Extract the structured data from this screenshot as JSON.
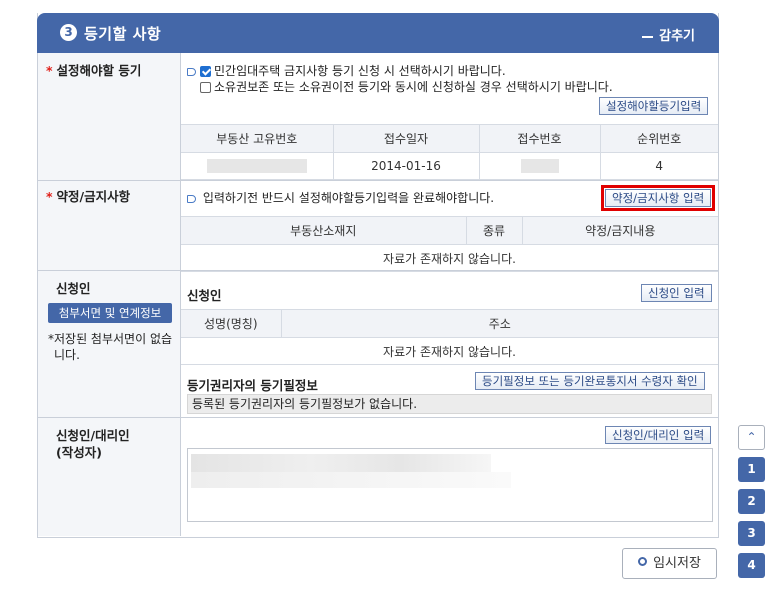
{
  "header": {
    "number": "3",
    "title": "등기할 사항",
    "fold_label": "감추기"
  },
  "registration": {
    "label": "설정해야할 등기",
    "option1": "민간임대주택 금지사항 등기 신청 시 선택하시기 바랍니다.",
    "option1_checked": true,
    "option2": "소유권보존 또는 소유권이전 등기와 동시에 신청하실 경우 선택하시기 바랍니다.",
    "option2_checked": false,
    "button": "설정해야할등기입력",
    "columns": [
      "부동산 고유번호",
      "접수일자",
      "접수번호",
      "순위번호"
    ],
    "row": {
      "receipt_date": "2014-01-16",
      "rank": "4"
    }
  },
  "covenant": {
    "label": "약정/금지사항",
    "notice": "입력하기전 반드시 설정해야할등기입력을 완료해야합니다.",
    "button": "약정/금지사항 입력",
    "columns": [
      "부동산소재지",
      "종류",
      "약정/금지내용"
    ],
    "empty": "자료가 존재하지 않습니다."
  },
  "applicant": {
    "label": "신청인",
    "attach_button": "첨부서면 및 연계정보",
    "note": "저장된 첨부서면이 없습니다.",
    "subtitle": "신청인",
    "button": "신청인 입력",
    "columns": [
      "성명(명칭)",
      "주소"
    ],
    "empty": "자료가 존재하지 않습니다.",
    "cert_title": "등기권리자의 등기필정보",
    "cert_button": "등기필정보 또는 등기완료통지서 수령자 확인",
    "cert_info": "등록된 등기권리자의 등기필정보가 없습니다."
  },
  "agent": {
    "label_line1": "신청인/대리인",
    "label_line2": "(작성자)",
    "button": "신청인/대리인 입력"
  },
  "footer": {
    "save_label": "임시저장"
  },
  "side_nav": {
    "items": [
      "1",
      "2",
      "3",
      "4"
    ]
  },
  "colors": {
    "accent": "#4467a8",
    "highlight": "#e00000"
  }
}
